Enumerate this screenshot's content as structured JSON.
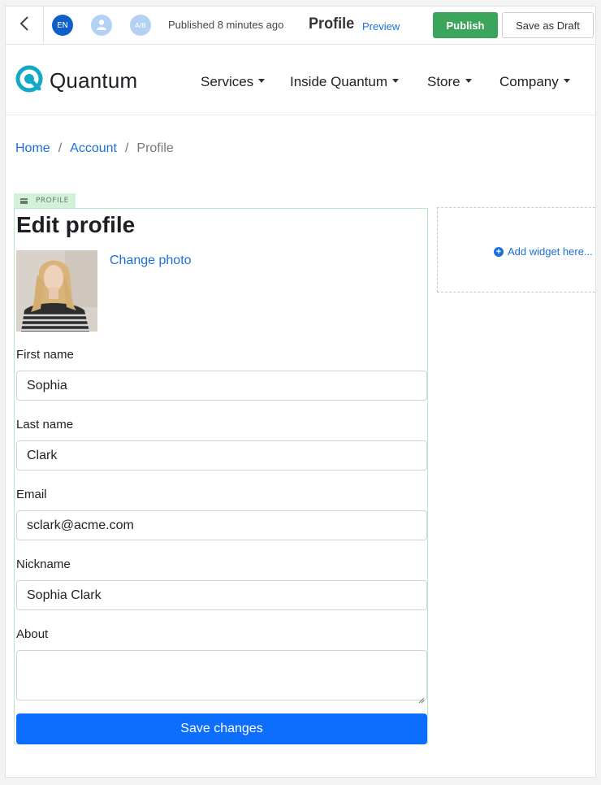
{
  "editor_bar": {
    "language": "EN",
    "ab_label": "A/B",
    "published_status": "Published 8 minutes ago",
    "page_name": "Profile",
    "preview_label": "Preview",
    "publish_label": "Publish",
    "save_draft_label": "Save as Draft"
  },
  "site": {
    "logo_text": "Quantum",
    "brand_color": "#12a9c6",
    "nav": [
      {
        "label": "Services"
      },
      {
        "label": "Inside Quantum"
      },
      {
        "label": "Store"
      },
      {
        "label": "Company"
      }
    ]
  },
  "breadcrumb": {
    "home": "Home",
    "account": "Account",
    "current": "Profile",
    "separator": "/"
  },
  "widget": {
    "tag": "PROFILE",
    "heading": "Edit profile",
    "change_photo_label": "Change photo",
    "fields": {
      "first_name": {
        "label": "First name",
        "value": "Sophia"
      },
      "last_name": {
        "label": "Last name",
        "value": "Clark"
      },
      "email": {
        "label": "Email",
        "value": "sclark@acme.com"
      },
      "nickname": {
        "label": "Nickname",
        "value": "Sophia Clark"
      },
      "about": {
        "label": "About",
        "value": ""
      }
    },
    "save_label": "Save changes"
  },
  "drop_zone": {
    "label": "Add widget here..."
  },
  "colors": {
    "publish": "#3ba55c",
    "primary": "#0d6efd",
    "link": "#1a6fdc"
  }
}
